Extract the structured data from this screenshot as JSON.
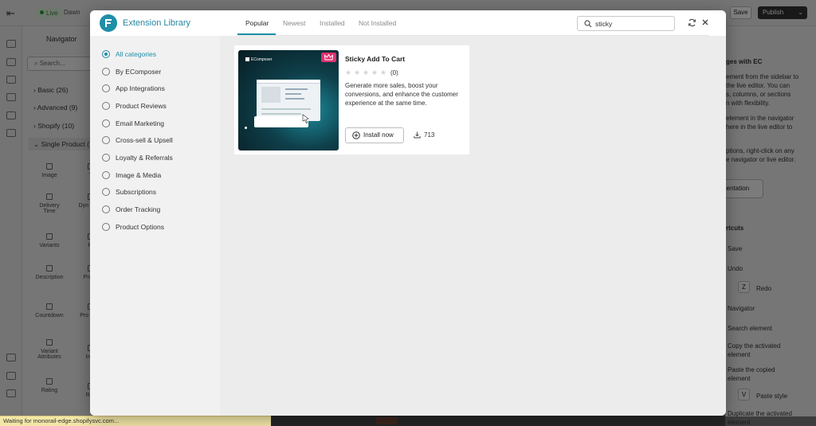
{
  "editor": {
    "live_badge": "Live",
    "theme_name": "Dawn",
    "save_label": "Save",
    "publish_label": "Publish",
    "navigator_title": "Navigator",
    "nav_search_placeholder": "Search...",
    "groups": [
      {
        "label": "Basic (26)"
      },
      {
        "label": "Advanced (9)"
      },
      {
        "label": "Shopify (10)"
      },
      {
        "label": "Single Product ("
      }
    ],
    "grid_items": [
      "Image",
      "Delivery Time",
      "Variants",
      "Description",
      "Countdown",
      "Variant Attributes",
      "Rating"
    ],
    "grid_items_right": [
      "Ti",
      "Dyn Chec",
      "Pr",
      "Produ",
      "Pro Prop",
      "Inve",
      "Rev"
    ],
    "right_text": [
      "ges with EC",
      "ement from the sidebar to",
      "the live editor. You can",
      "s, columns, or sections",
      "n with flexibility.",
      "element in the navigator",
      "here in the live editor to",
      "ptions, right-click on any",
      "e navigator or live editor."
    ],
    "documentation_label": "mentation",
    "shortcuts_title": "rtcuts",
    "shortcuts": [
      {
        "label": "Save"
      },
      {
        "label": "Undo"
      },
      {
        "key": "Z",
        "label": "Redo"
      },
      {
        "label": "Navigator"
      },
      {
        "label": "Search element"
      },
      {
        "label": "Copy the activated element"
      },
      {
        "label": "Paste the copied element"
      },
      {
        "key": "V",
        "label": "Paste style"
      },
      {
        "label": "Duplicate the activated element"
      }
    ],
    "status_text": "Waiting for monorail-edge.shopifysvc.com..."
  },
  "modal": {
    "title": "Extension Library",
    "tabs": [
      {
        "label": "Popular",
        "active": true
      },
      {
        "label": "Newest"
      },
      {
        "label": "Installed"
      },
      {
        "label": "Not Installed"
      }
    ],
    "search": {
      "value": "sticky",
      "placeholder": "Search"
    },
    "categories": [
      {
        "label": "All categories",
        "active": true
      },
      {
        "label": "By EComposer"
      },
      {
        "label": "App Integrations"
      },
      {
        "label": "Product Reviews"
      },
      {
        "label": "Email Marketing"
      },
      {
        "label": "Cross-sell & Upsell"
      },
      {
        "label": "Loyalty & Referrals"
      },
      {
        "label": "Image & Media"
      },
      {
        "label": "Subscriptions"
      },
      {
        "label": "Order Tracking"
      },
      {
        "label": "Product Options"
      }
    ],
    "card": {
      "brand": "EComposer",
      "title": "Sticky Add To Cart",
      "rating_stars": 0,
      "rating_count": "(0)",
      "description": "Generate more sales, boost your conversions, and enhance the customer experience at the same time.",
      "install_label": "Install now",
      "downloads": "713"
    }
  },
  "colors": {
    "accent": "#1f8ea8",
    "crown_badge": "#e0306f",
    "status_bar": "#f3e7a8"
  }
}
